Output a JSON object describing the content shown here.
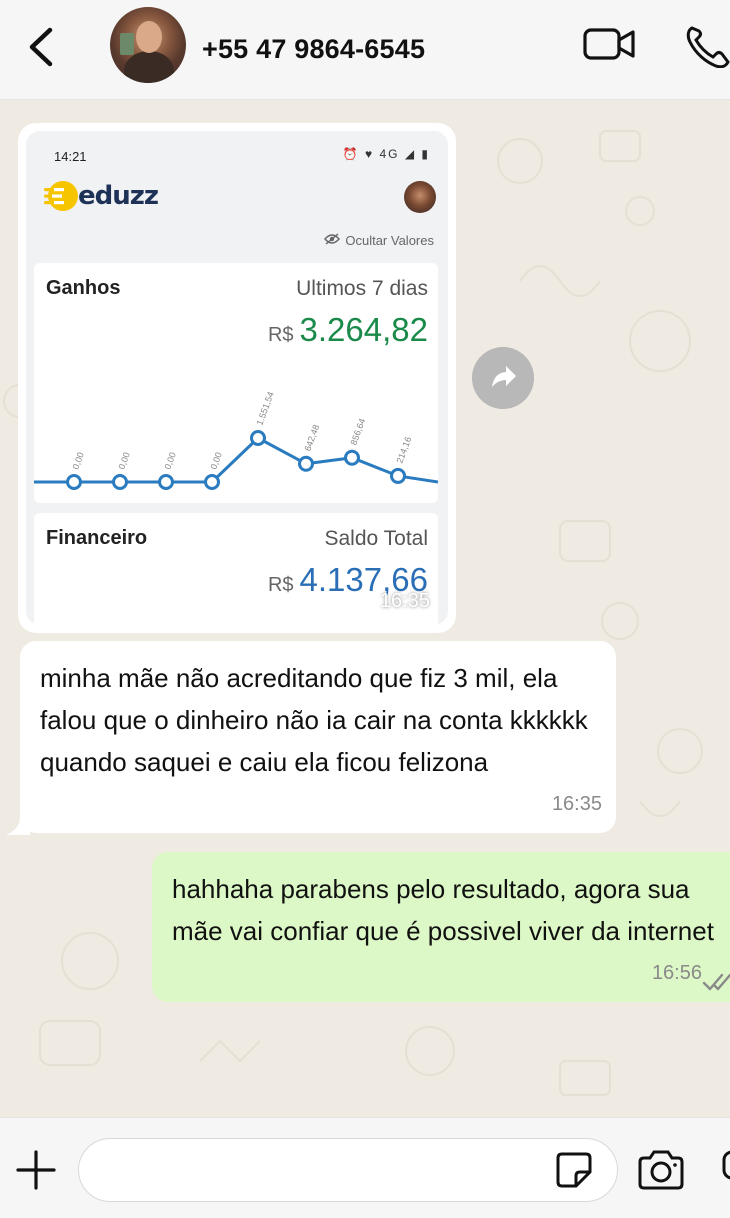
{
  "header": {
    "contact_name": "+55 47 9864-6545",
    "back_icon": "chevron-left-icon",
    "video_icon": "video-camera-icon",
    "call_icon": "phone-icon"
  },
  "image_message": {
    "time": "16:35",
    "screenshot": {
      "status_time": "14:21",
      "status_icons": "⏰ ♥ 4G ◢ ▮",
      "brand": "eduzz",
      "hide_values": "Ocultar Valores",
      "earnings_card": {
        "title": "Ganhos",
        "period": "Ultimos 7 dias",
        "currency": "R$",
        "amount": "3.264,82"
      },
      "finance_card": {
        "title": "Financeiro",
        "subtitle": "Saldo Total",
        "currency": "R$",
        "amount": "4.137,66"
      }
    },
    "forward_icon": "forward-arrow-icon"
  },
  "chart_data": {
    "type": "line",
    "categories": [
      "1",
      "2",
      "3",
      "4",
      "5",
      "6",
      "7",
      "8"
    ],
    "series": [
      {
        "values": [
          0,
          0,
          0,
          0,
          1551.54,
          642.48,
          856.64,
          214.16
        ]
      }
    ],
    "point_labels": [
      "0,00",
      "0,00",
      "0,00",
      "0,00",
      "1.551,54",
      "642,48",
      "856,64",
      "214,16"
    ],
    "color": "#2a7bbf"
  },
  "messages": [
    {
      "direction": "incoming",
      "text": "minha mãe não acreditando que fiz 3 mil, ela falou que o dinheiro não ia cair na conta kkkkkk quando saquei e caiu ela ficou felizona",
      "time": "16:35"
    },
    {
      "direction": "outgoing",
      "text": "hahhaha parabens pelo resultado, agora sua mãe vai confiar que é possivel viver da internet",
      "time": "16:56",
      "status_icon": "double-check-icon"
    }
  ],
  "composer": {
    "value": "",
    "plus_icon": "plus-icon",
    "sticker_icon": "sticker-icon",
    "camera_icon": "camera-icon",
    "mic_icon": "microphone-icon"
  }
}
